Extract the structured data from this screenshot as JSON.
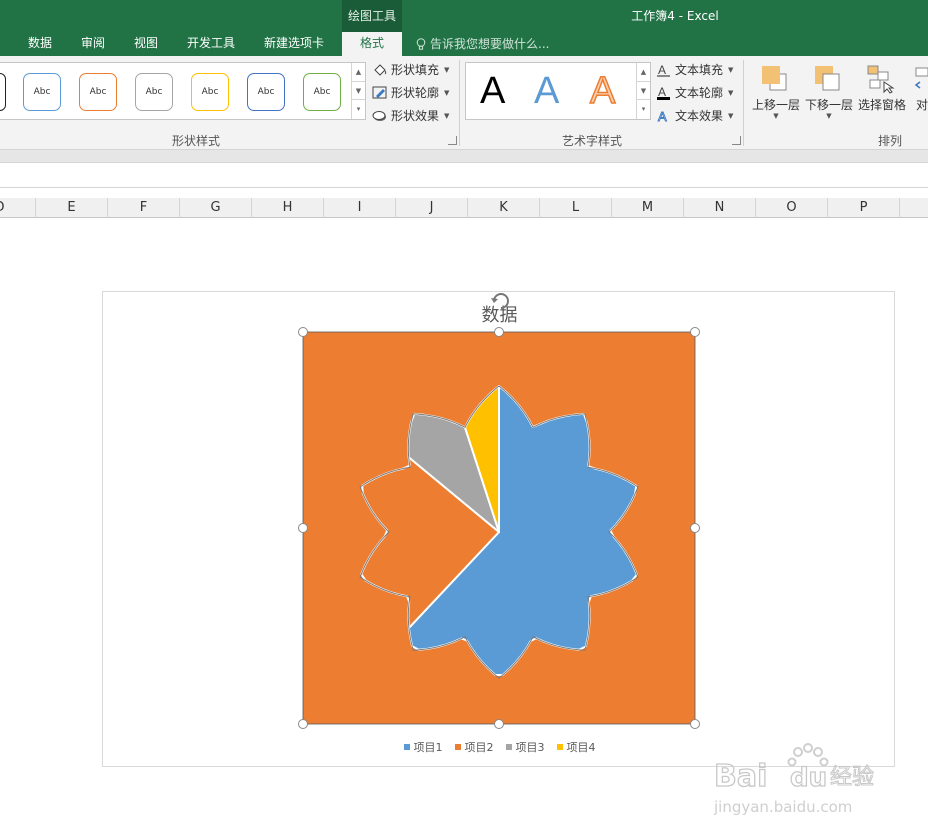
{
  "titlebar": {
    "context_group": "绘图工具",
    "app_title": "工作簿4 - Excel",
    "tabs": [
      "数据",
      "审阅",
      "视图",
      "开发工具",
      "新建选项卡"
    ],
    "active_tab": "格式",
    "tell_me": "告诉我您想要做什么..."
  },
  "ribbon": {
    "shape_style_samples": [
      "Abc",
      "Abc",
      "Abc",
      "Abc",
      "Abc",
      "Abc"
    ],
    "shape_commands": [
      "形状填充",
      "形状轮廓",
      "形状效果"
    ],
    "shape_group_label": "形状样式",
    "wordart_samples": [
      "A",
      "A",
      "A"
    ],
    "text_commands": [
      "文本填充",
      "文本轮廓",
      "文本效果"
    ],
    "wordart_group_label": "艺术字样式",
    "arrange_buttons": [
      "上移一层",
      "下移一层",
      "选择窗格"
    ],
    "arrange_partial": "对",
    "arrange_group_label": "排列"
  },
  "columns": [
    "D",
    "E",
    "F",
    "G",
    "H",
    "I",
    "J",
    "K",
    "L",
    "M",
    "N",
    "O",
    "P"
  ],
  "chart_data": {
    "type": "pie",
    "title": "数据",
    "categories": [
      "项目1",
      "项目2",
      "项目3",
      "项目4"
    ],
    "values": [
      62,
      24,
      9,
      5
    ],
    "colors": [
      "#5b9bd5",
      "#ed7d31",
      "#a5a5a5",
      "#ffc000"
    ],
    "plot_area_fill": "#ed7d31",
    "legend_position": "bottom"
  },
  "watermark": {
    "brand": "Bai 经验",
    "url": "jingyan.baidu.com"
  }
}
